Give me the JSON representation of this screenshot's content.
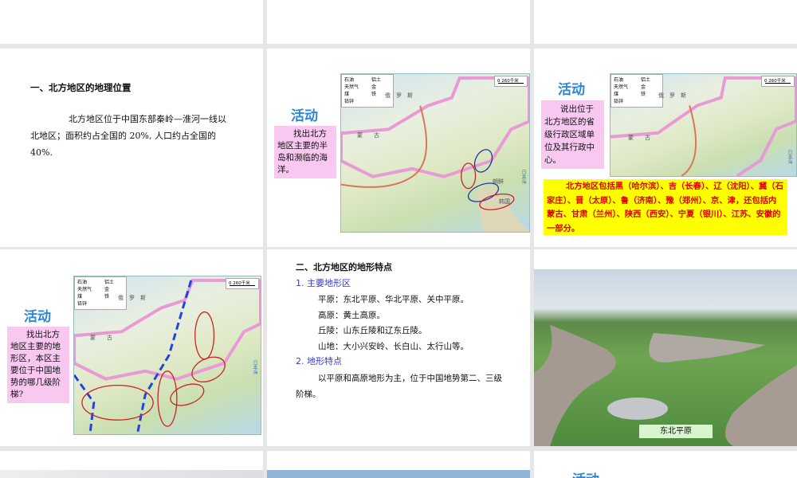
{
  "slides": {
    "s1": {
      "heading": "一、北方地区的地理位置",
      "body": "北方地区位于中国东部秦岭—淮河一线以北地区；面积约占全国的 20%, 人口约占全国的 40%."
    },
    "s2": {
      "activity": "活动",
      "task": "找出北方地区主要的半岛和濒临的海洋。"
    },
    "s3": {
      "activity": "活动",
      "task": "说出位于北方地区的省级行政区域单位及其行政中心。",
      "answer": "北方地区包括黑（哈尔滨）、吉（长春）、辽（沈阳）、冀（石家庄）、晋（太原）、鲁（济南）、豫（郑州）、京、津，还包括内蒙古、甘肃（兰州）、陕西（西安）、宁夏（银川）、江苏、安徽的一部分。"
    },
    "s4": {
      "activity": "活动",
      "task": "找出北方地区主要的地形区，本区主要位于中国地势的哪几级阶梯?"
    },
    "s5": {
      "heading": "二、北方地区的地形特点",
      "sub1": "1. 主要地形区",
      "lines": [
        "平原：东北平原、华北平原、关中平原。",
        "高原：黄土高原。",
        "丘陵：山东丘陵和辽东丘陵。",
        "山地：大小兴安岭、长白山、太行山等。"
      ],
      "sub2": "2. 地形特点",
      "body": "以平原和高原地形为主，位于中国地势第二、三级阶梯。"
    },
    "s6": {
      "caption": "东北平原"
    },
    "s9": {
      "activity": "活动"
    }
  },
  "map": {
    "legend": [
      "石油",
      "铝土",
      "天然气",
      "金",
      "煤",
      "铁",
      "铅锌"
    ],
    "scale": "0    260千米",
    "labels": {
      "russia": "俄　罗　斯",
      "mongolia": "蒙　　古",
      "korea": "朝鲜",
      "sk": "韩国",
      "japan_sea": "日本海"
    }
  },
  "colors": {
    "activity": "#2e86d6",
    "pink_box": "#f8c8f0",
    "yellow_box": "#ffff00",
    "answer_text": "#e00000",
    "subhead": "#3a3acc"
  }
}
